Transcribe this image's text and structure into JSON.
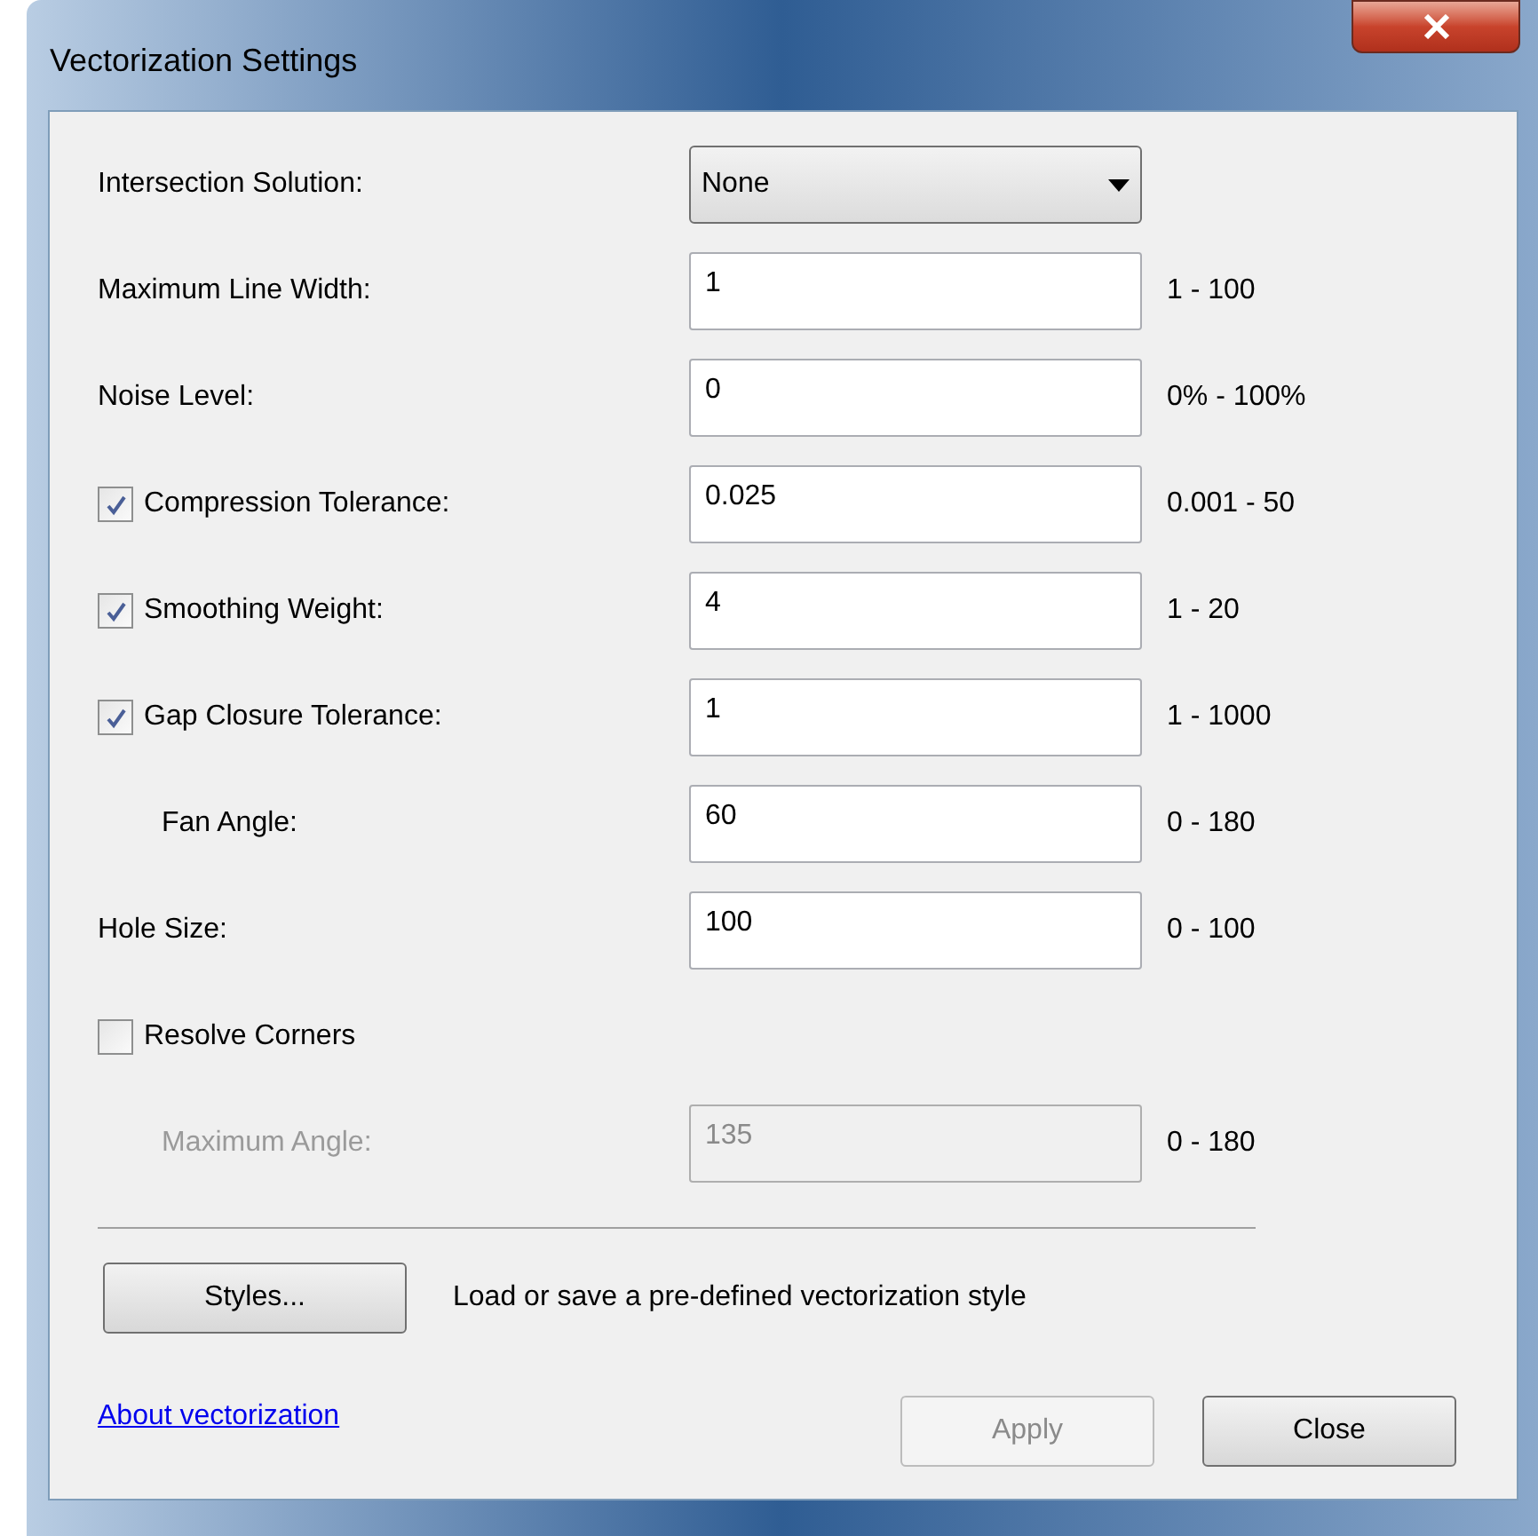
{
  "window": {
    "title": "Vectorization Settings"
  },
  "rows": [
    {
      "kind": "select",
      "label": "Intersection Solution:",
      "value": "None"
    },
    {
      "kind": "field",
      "label": "Maximum Line Width:",
      "value": "1",
      "range": "1 - 100"
    },
    {
      "kind": "field",
      "label": "Noise Level:",
      "value": "0",
      "range": "0% - 100%"
    },
    {
      "kind": "check_field",
      "label": "Compression Tolerance:",
      "checked": true,
      "value": "0.025",
      "range": "0.001 - 50"
    },
    {
      "kind": "check_field",
      "label": "Smoothing Weight:",
      "checked": true,
      "value": "4",
      "range": "1 - 20"
    },
    {
      "kind": "check_field",
      "label": "Gap Closure Tolerance:",
      "checked": true,
      "value": "1",
      "range": "1 - 1000"
    },
    {
      "kind": "sub_field",
      "label": "Fan Angle:",
      "value": "60",
      "range": "0 - 180",
      "disabled": false
    },
    {
      "kind": "field",
      "label": "Hole Size:",
      "value": "100",
      "range": "0 - 100"
    },
    {
      "kind": "checkbox",
      "label": "Resolve Corners",
      "checked": false
    },
    {
      "kind": "sub_field",
      "label": "Maximum Angle:",
      "value": "135",
      "range": "0 - 180",
      "disabled": true
    }
  ],
  "styles": {
    "button": "Styles...",
    "description": "Load or save a pre-defined vectorization style"
  },
  "link": "About vectorization",
  "buttons": [
    {
      "label": "Apply",
      "disabled": true
    },
    {
      "label": "Close",
      "disabled": false
    }
  ]
}
